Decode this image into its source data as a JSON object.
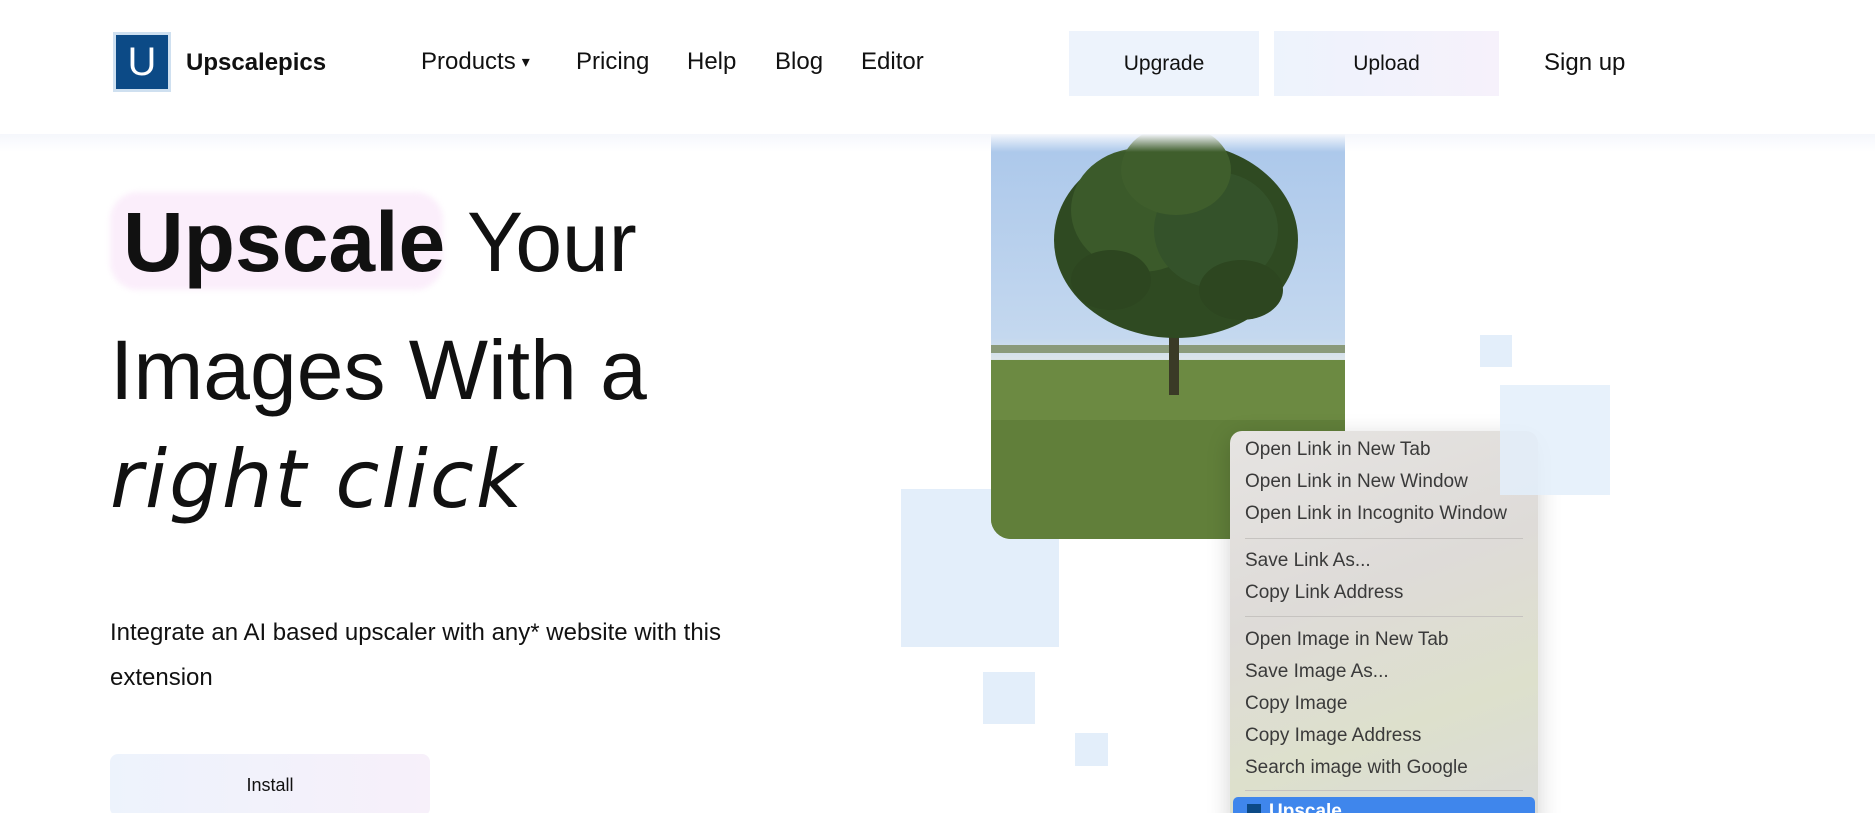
{
  "header": {
    "logo_letter": "U",
    "brand": "Upscalepics",
    "nav": {
      "products": "Products",
      "products_caret": "▾",
      "pricing": "Pricing",
      "help": "Help",
      "blog": "Blog",
      "editor": "Editor"
    },
    "upgrade_label": "Upgrade",
    "upload_label": "Upload",
    "signup_label": "Sign up"
  },
  "hero": {
    "title_bold": "Upscale",
    "title_rest": " Your",
    "title_line2": "Images With a",
    "title_line3": "right click",
    "description": "Integrate an AI based upscaler with any* website with this extension",
    "install_label": "Install"
  },
  "context_menu": {
    "items": [
      "Open Link in New Tab",
      "Open Link in New Window",
      "Open Link in Incognito Window",
      "Save Link As...",
      "Copy Link Address",
      "Open Image in New Tab",
      "Save Image As...",
      "Copy Image",
      "Copy Image Address",
      "Search image with Google"
    ],
    "highlighted": "Upscale"
  },
  "colors": {
    "logo": "#0c4a86",
    "button_bg": "#edf3fc",
    "highlight_pink": "#fbeefb",
    "menu_highlight": "#3f86ec",
    "decor_square": "#e3eefa"
  }
}
